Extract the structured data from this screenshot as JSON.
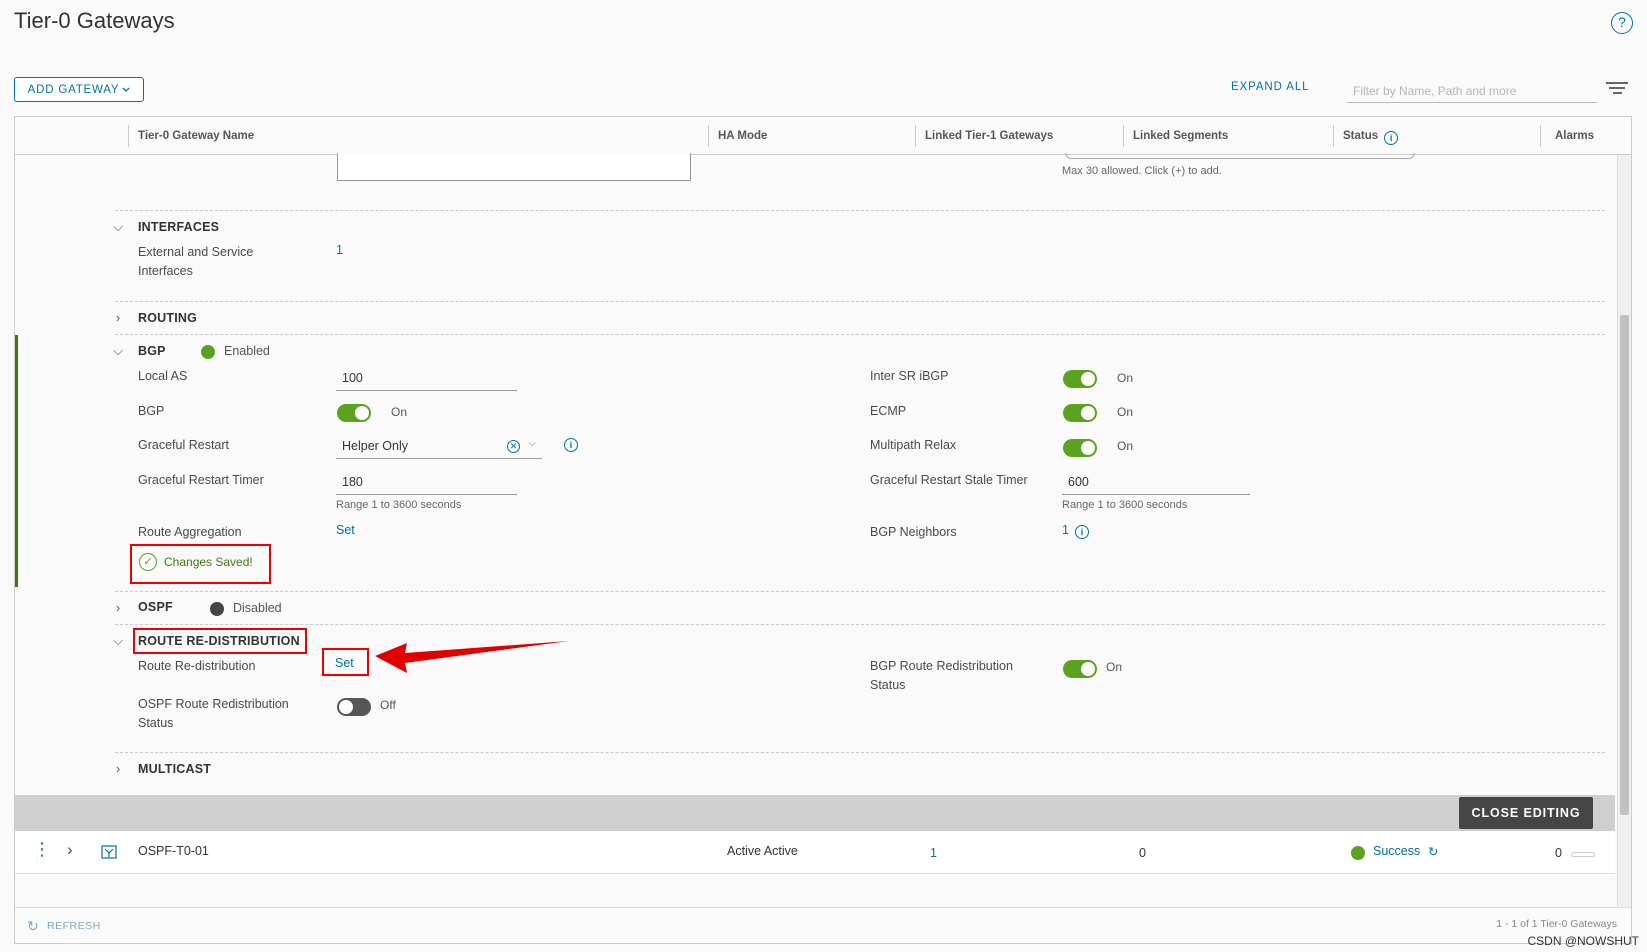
{
  "header": {
    "title": "Tier-0 Gateways",
    "help_glyph": "?",
    "add_gateway_label": "ADD GATEWAY",
    "expand_all_label": "EXPAND ALL",
    "filter_placeholder": "Filter by Name, Path and more"
  },
  "columns": {
    "name": "Tier-0 Gateway Name",
    "ha_mode": "HA Mode",
    "linked_t1": "Linked Tier-1 Gateways",
    "linked_segments": "Linked Segments",
    "status": "Status",
    "alarms": "Alarms",
    "info_glyph": "i"
  },
  "top": {
    "max_hint": "Max 30 allowed. Click (+) to add."
  },
  "interfaces": {
    "title": "INTERFACES",
    "label_line1": "External and Service",
    "label_line2": "Interfaces",
    "count": "1"
  },
  "routing": {
    "title": "ROUTING"
  },
  "bgp": {
    "title": "BGP",
    "state": "Enabled",
    "state_color": "#5aa220",
    "local_as_label": "Local AS",
    "local_as_value": "100",
    "bgp_label": "BGP",
    "bgp_toggle": "On",
    "graceful_restart_label": "Graceful Restart",
    "graceful_restart_value": "Helper Only",
    "graceful_timer_label": "Graceful Restart Timer",
    "graceful_timer_value": "180",
    "graceful_timer_hint": "Range 1 to 3600 seconds",
    "route_aggregation_label": "Route Aggregation",
    "route_aggregation_link": "Set",
    "inter_sr_label": "Inter SR iBGP",
    "inter_sr_toggle": "On",
    "ecmp_label": "ECMP",
    "ecmp_toggle": "On",
    "multipath_label": "Multipath Relax",
    "multipath_toggle": "On",
    "stale_timer_label": "Graceful Restart Stale Timer",
    "stale_timer_value": "600",
    "stale_timer_hint": "Range 1 to 3600 seconds",
    "neighbors_label": "BGP Neighbors",
    "neighbors_count": "1",
    "changes_saved": "Changes Saved!"
  },
  "ospf": {
    "title": "OSPF",
    "state": "Disabled",
    "state_color": "#444444"
  },
  "redistribution": {
    "title": "ROUTE RE-DISTRIBUTION",
    "label": "Route Re-distribution",
    "link": "Set",
    "bgp_status_line1": "BGP Route Redistribution",
    "bgp_status_line2": "Status",
    "bgp_toggle": "On",
    "ospf_status_line1": "OSPF Route Redistribution",
    "ospf_status_line2": "Status",
    "ospf_toggle": "Off"
  },
  "multicast": {
    "title": "MULTICAST"
  },
  "close_editing_label": "CLOSE EDITING",
  "gateway_row": {
    "name": "OSPF-T0-01",
    "ha_mode": "Active Active",
    "linked_t1": "1",
    "linked_segments": "0",
    "status": "Success",
    "status_color": "#5aa220",
    "alarms": "0"
  },
  "footer": {
    "refresh_label": "REFRESH",
    "pagination": "1 - 1 of 1 Tier-0 Gateways",
    "watermark": "CSDN @NOWSHUT"
  },
  "colors": {
    "accent": "#0072a3",
    "toggle_on": "#5aa220",
    "annotation_red": "#e00000"
  }
}
